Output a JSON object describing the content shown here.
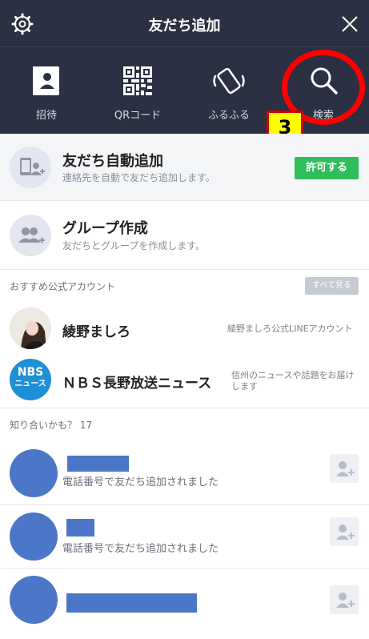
{
  "header": {
    "title": "友だち追加"
  },
  "actions": [
    {
      "label": "招待"
    },
    {
      "label": "QRコード"
    },
    {
      "label": "ふるふる"
    },
    {
      "label": "検索"
    }
  ],
  "annotation": {
    "badge": "3",
    "color": "#ff0000"
  },
  "auto_add": {
    "title": "友だち自動追加",
    "subtitle": "連絡先を自動で友だち追加します。",
    "button": "許可する"
  },
  "group": {
    "title": "グループ作成",
    "subtitle": "友だちとグループを作成します。"
  },
  "recommended": {
    "label": "おすすめ公式アカウント",
    "see_all": "すべて見る",
    "accounts": [
      {
        "name": "綾野ましろ",
        "desc": "綾野ましろ公式LINEアカウント"
      },
      {
        "name": "ＮＢＳ長野放送ニュース",
        "desc_line1": "信州のニュースや話題をお届け",
        "desc_line2": "します",
        "logo_top": "NBS",
        "logo_bottom": "ニュース"
      }
    ]
  },
  "maybe": {
    "label": "知り合いかも？ 17",
    "people": [
      {
        "subtitle": "電話番号で友だち追加されました"
      },
      {
        "subtitle": "電話番号で友だち追加されました"
      },
      {
        "subtitle": ""
      }
    ]
  },
  "colors": {
    "header_bg": "#2b3042",
    "accent_green": "#2fbe5a",
    "redaction_blue": "#4c77c8"
  }
}
